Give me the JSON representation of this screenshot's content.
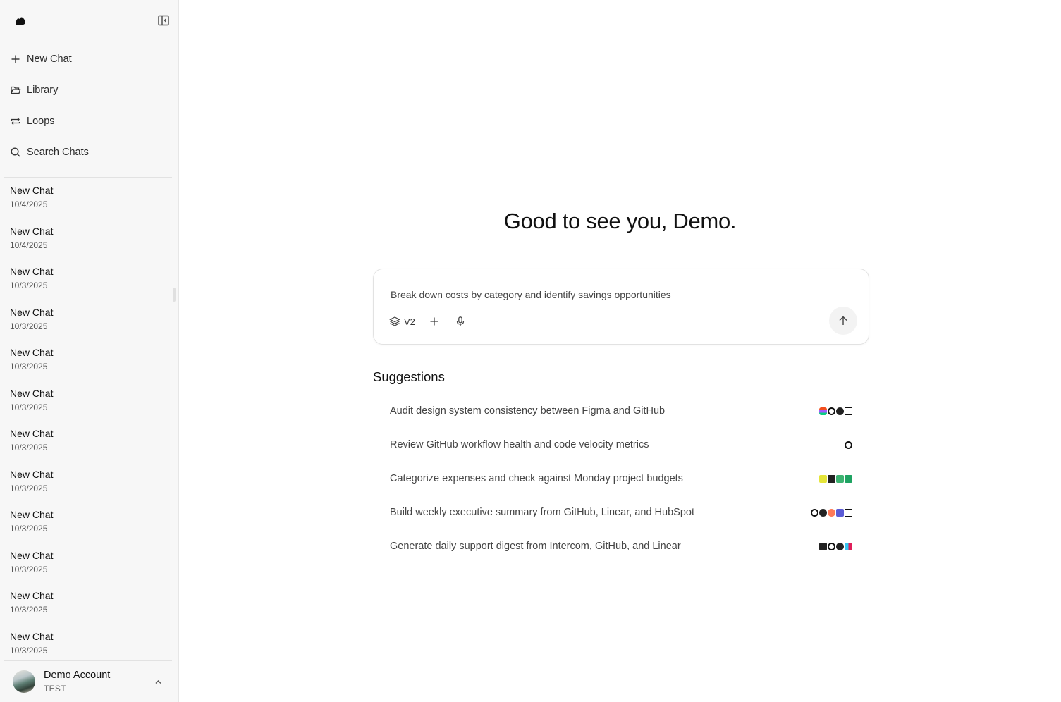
{
  "sidebar": {
    "nav": [
      {
        "label": "New Chat",
        "icon": "plus-icon"
      },
      {
        "label": "Library",
        "icon": "folder-icon"
      },
      {
        "label": "Loops",
        "icon": "repeat-icon"
      },
      {
        "label": "Search Chats",
        "icon": "search-icon"
      }
    ],
    "chats": [
      {
        "title": "New Chat",
        "date": "10/4/2025"
      },
      {
        "title": "New Chat",
        "date": "10/4/2025"
      },
      {
        "title": "New Chat",
        "date": "10/3/2025"
      },
      {
        "title": "New Chat",
        "date": "10/3/2025"
      },
      {
        "title": "New Chat",
        "date": "10/3/2025"
      },
      {
        "title": "New Chat",
        "date": "10/3/2025"
      },
      {
        "title": "New Chat",
        "date": "10/3/2025"
      },
      {
        "title": "New Chat",
        "date": "10/3/2025"
      },
      {
        "title": "New Chat",
        "date": "10/3/2025"
      },
      {
        "title": "New Chat",
        "date": "10/3/2025"
      },
      {
        "title": "New Chat",
        "date": "10/3/2025"
      },
      {
        "title": "New Chat",
        "date": "10/3/2025"
      }
    ],
    "account": {
      "name": "Demo Account",
      "plan": "TEST"
    }
  },
  "main": {
    "greeting": "Good to see you, Demo.",
    "composer": {
      "text": "Break down costs by category and identify savings opportunities",
      "model_label": "V2"
    },
    "suggestions_title": "Suggestions",
    "suggestions": [
      {
        "label": "Audit design system consistency between Figma and GitHub",
        "icons": [
          "figma",
          "github",
          "linear",
          "notion"
        ]
      },
      {
        "label": "Review GitHub workflow health and code velocity metrics",
        "icons": [
          "github"
        ]
      },
      {
        "label": "Categorize expenses and check against Monday project budgets",
        "icons": [
          "bolt",
          "yellow2",
          "green",
          "sheets"
        ]
      },
      {
        "label": "Build weekly executive summary from GitHub, Linear, and HubSpot",
        "icons": [
          "github",
          "linear",
          "hubspot",
          "purple",
          "notion"
        ]
      },
      {
        "label": "Generate daily support digest from Intercom, GitHub, and Linear",
        "icons": [
          "intercom",
          "github",
          "linear",
          "slack"
        ]
      }
    ]
  }
}
